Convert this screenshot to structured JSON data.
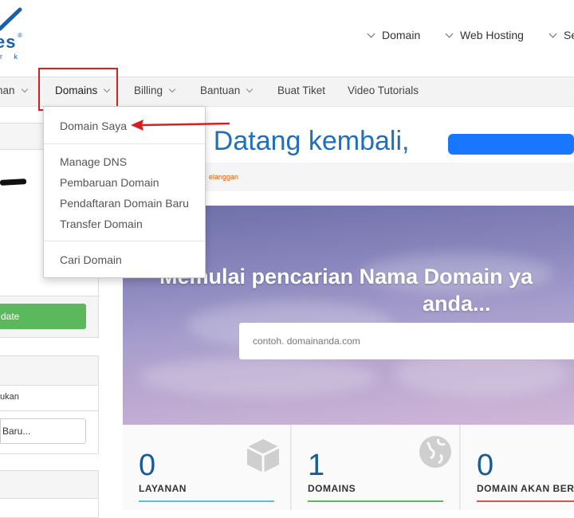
{
  "header": {
    "logo": {
      "brand_visible": "es",
      "tagline_visible": "r k",
      "registered_mark": "®"
    },
    "top_links": [
      "Domain",
      "Web Hosting",
      "Se"
    ]
  },
  "nav": {
    "items": [
      "nan",
      "Domains",
      "Billing",
      "Bantuan",
      "Buat Tiket",
      "Video Tutorials"
    ],
    "active": "Domains",
    "highlight_color": "#d62020"
  },
  "dropdown": {
    "items": [
      {
        "label": "Domain Saya",
        "group": 1
      },
      {
        "label": "Manage DNS",
        "group": 2
      },
      {
        "label": "Pembaruan Domain",
        "group": 2
      },
      {
        "label": "Pendaftaran Domain Baru",
        "group": 2
      },
      {
        "label": "Transfer Domain",
        "group": 2
      },
      {
        "label": "Cari Domain",
        "group": 3
      }
    ],
    "arrow_color": "#d62020"
  },
  "sidebar": {
    "update_button": "date",
    "ukan_text": "ukan",
    "input_value": "Baru..."
  },
  "main": {
    "title": "at Datang kembali,",
    "breadcrumb": "elanggan",
    "hero": {
      "title_line1": "Memulai pencarian Nama Domain ya",
      "title_line2": "anda...",
      "search_placeholder": "contoh. domainanda.com"
    },
    "stats": [
      {
        "number": "0",
        "label": "LAYANAN",
        "color": "#5bc0de"
      },
      {
        "number": "1",
        "label": "DOMAINS",
        "color": "#5cb85c"
      },
      {
        "number": "0",
        "label": "DOMAIN AKAN BERA",
        "color": "#d9534f"
      }
    ]
  },
  "colors": {
    "accent": "#1f6fbd",
    "success": "#5cb85c",
    "redaction": "#1976ff"
  }
}
